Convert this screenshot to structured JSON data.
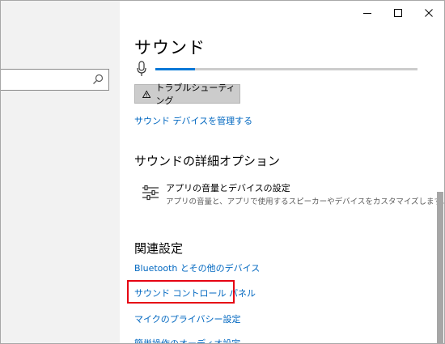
{
  "window": {
    "minimize_label": "—",
    "maximize_label": "☐",
    "close_label": "✕"
  },
  "sound": {
    "title": "サウンド",
    "input_level": 0.15,
    "troubleshoot_label": "トラブルシューティング",
    "manage_devices_link": "サウンド デバイスを管理する"
  },
  "advanced": {
    "title": "サウンドの詳細オプション",
    "item_title": "アプリの音量とデバイスの設定",
    "item_desc": "アプリの音量と、アプリで使用するスピーカーやデバイスをカスタマイズします。"
  },
  "related": {
    "title": "関連設定",
    "links": [
      "Bluetooth とその他のデバイス",
      "サウンド コントロール パネル",
      "マイクのプライバシー設定",
      "簡単操作のオーディオ設定"
    ]
  },
  "colors": {
    "accent": "#0078d7",
    "link": "#0067c0",
    "highlight": "#e60012"
  }
}
